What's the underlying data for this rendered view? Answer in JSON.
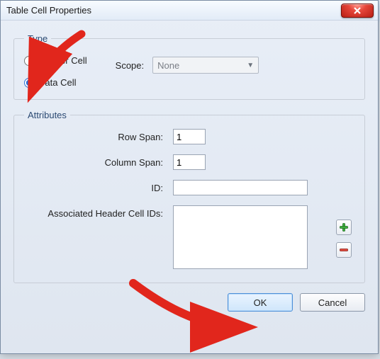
{
  "window": {
    "title": "Table Cell Properties"
  },
  "type": {
    "legend": "Type",
    "header_label": "Header Cell",
    "data_label": "Data Cell",
    "selected": "data",
    "scope_label": "Scope:",
    "scope_value": "None"
  },
  "attributes": {
    "legend": "Attributes",
    "row_span_label": "Row Span:",
    "row_span_value": "1",
    "col_span_label": "Column Span:",
    "col_span_value": "1",
    "id_label": "ID:",
    "id_value": "",
    "assoc_label": "Associated Header Cell IDs:",
    "assoc_value": ""
  },
  "buttons": {
    "ok": "OK",
    "cancel": "Cancel"
  }
}
